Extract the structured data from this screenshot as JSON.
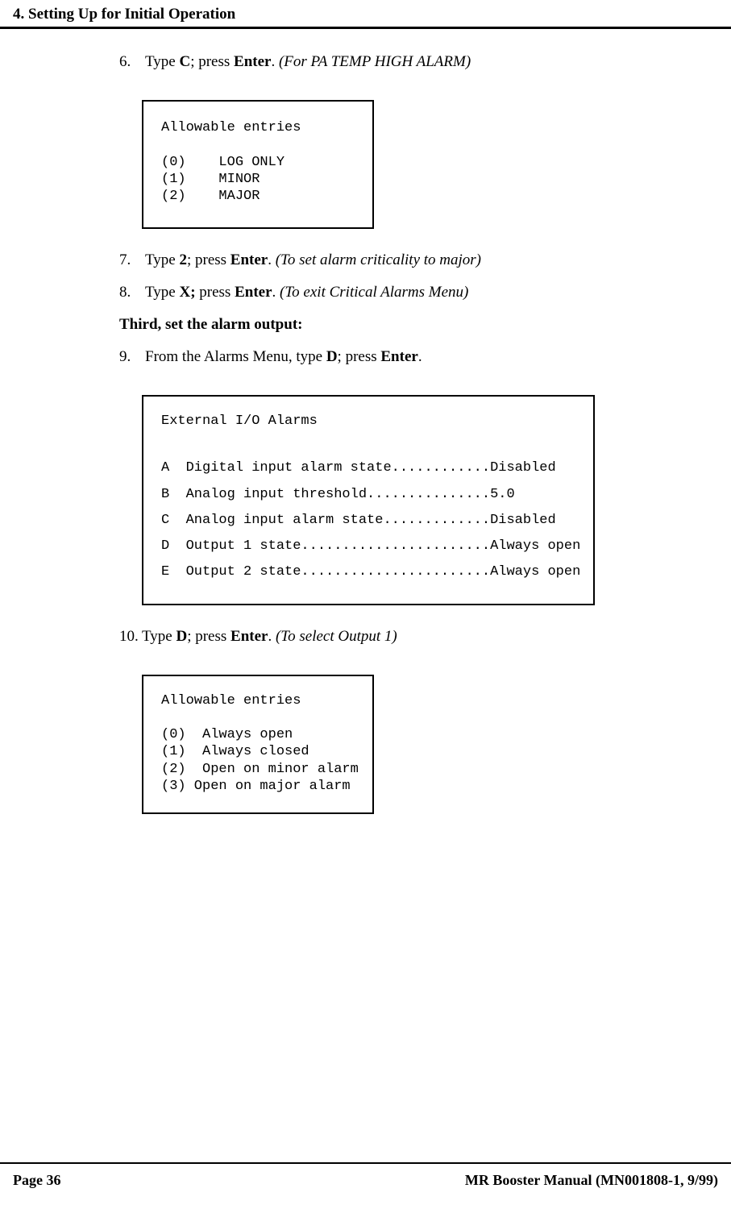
{
  "header": {
    "title": "4. Setting Up for Initial Operation"
  },
  "steps": {
    "s6": {
      "num": "6.",
      "pre": "Type ",
      "key1": "C",
      "mid1": "; press ",
      "key2": "Enter",
      "mid2": ". ",
      "note": "(For PA TEMP HIGH ALARM)"
    },
    "s7": {
      "num": "7.",
      "pre": "Type ",
      "key1": "2",
      "mid1": "; press ",
      "key2": "Enter",
      "mid2": ". ",
      "note": "(To set alarm criticality to major)"
    },
    "s8": {
      "num": "8.",
      "pre": "Type ",
      "key1": "X;",
      "mid1": " press ",
      "key2": "Enter",
      "mid2": ". ",
      "note": "(To exit Critical Alarms Menu)"
    },
    "s9": {
      "num": "9.",
      "pre": "From the Alarms Menu, type ",
      "key1": "D",
      "mid1": "; press ",
      "key2": "Enter",
      "mid2": "."
    },
    "s10": {
      "num": "10.",
      "pre": "Type ",
      "key1": "D",
      "mid1": "; press ",
      "key2": "Enter",
      "mid2": ". ",
      "note": "(To select Output 1)"
    }
  },
  "subheading": "Third, set the alarm output:",
  "box1": {
    "title": "Allowable entries",
    "l0": "(0)    LOG ONLY",
    "l1": "(1)    MINOR",
    "l2": "(2)    MAJOR"
  },
  "box2": {
    "title": "External I/O Alarms",
    "a": "A  Digital input alarm state............Disabled",
    "b": "B  Analog input threshold...............5.0",
    "c": "C  Analog input alarm state.............Disabled",
    "d": "D  Output 1 state.......................Always open",
    "e": "E  Output 2 state.......................Always open"
  },
  "box3": {
    "title": "Allowable entries",
    "l0": "(0)  Always open",
    "l1": "(1)  Always closed",
    "l2": "(2)  Open on minor alarm",
    "l3": "(3) Open on major alarm"
  },
  "footer": {
    "left": "Page 36",
    "right": "MR Booster Manual (MN001808-1, 9/99)"
  }
}
